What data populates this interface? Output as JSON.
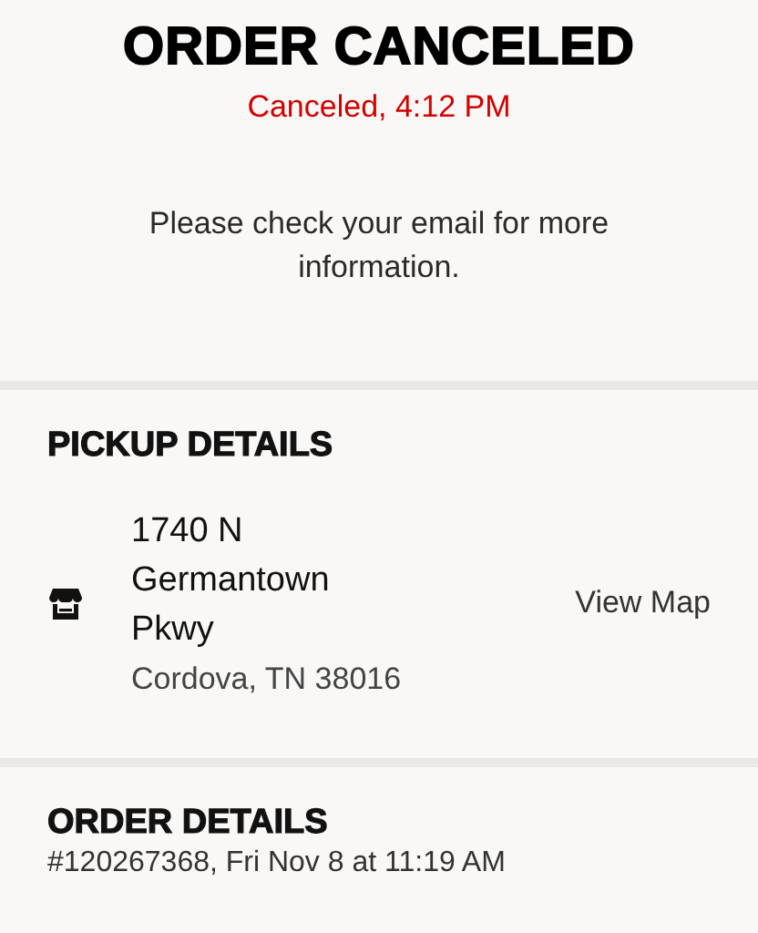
{
  "status": {
    "title": "ORDER CANCELED",
    "subtitle": "Canceled, 4:12 PM",
    "message": "Please check your email for more information."
  },
  "pickup": {
    "heading": "PICKUP DETAILS",
    "address": "1740 N Germantown Pkwy",
    "city": "Cordova, TN 38016",
    "link": "View Map"
  },
  "order": {
    "heading": "ORDER DETAILS",
    "summary": "#120267368, Fri Nov 8 at 11:19 AM"
  }
}
